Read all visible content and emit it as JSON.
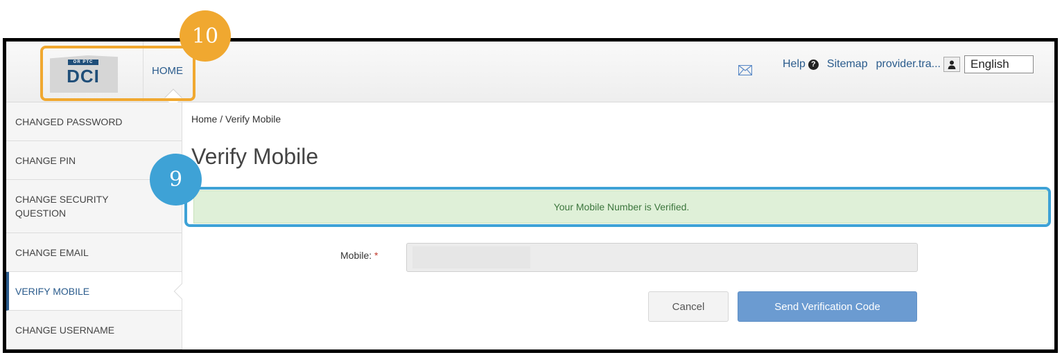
{
  "annotations": {
    "step_10": "10",
    "step_9": "9"
  },
  "navbar": {
    "logo_small": "OR PTC",
    "logo_main": "DCI",
    "home_label": "HOME",
    "help_label": "Help",
    "sitemap_label": "Sitemap",
    "username": "provider.tra...",
    "language": "English"
  },
  "sidebar": {
    "items": [
      {
        "label": "CHANGED PASSWORD"
      },
      {
        "label": "CHANGE PIN"
      },
      {
        "label": "CHANGE SECURITY QUESTION"
      },
      {
        "label": "CHANGE EMAIL"
      },
      {
        "label": "VERIFY MOBILE"
      },
      {
        "label": "CHANGE USERNAME"
      }
    ]
  },
  "main": {
    "breadcrumb": "Home / Verify Mobile",
    "title": "Verify Mobile",
    "alert": "Your Mobile Number is Verified.",
    "mobile_label": "Mobile:",
    "required_mark": "*",
    "cancel_label": "Cancel",
    "send_label": "Send Verification Code"
  },
  "colors": {
    "accent": "#2a5b8c",
    "success_bg": "#dff0d8",
    "primary_btn": "#6b9bd1",
    "annot_orange": "#f0a830",
    "annot_blue": "#3ea2d6"
  }
}
